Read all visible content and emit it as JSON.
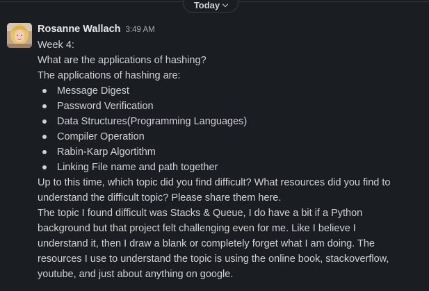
{
  "divider": {
    "label": "Today"
  },
  "message": {
    "author": "Rosanne Wallach",
    "time": "3:49 AM",
    "lines_intro": [
      "Week 4:",
      "What are the applications of hashing?",
      "The applications of hashing are:"
    ],
    "applications": [
      "Message Digest",
      "Password Verification",
      "Data Structures(Programming Languages)",
      "Compiler Operation",
      "Rabin-Karp Algortithm",
      "Linking File name and path together"
    ],
    "lines_question": [
      "Up to this time, which topic did you find difficult? What resources did you find to",
      "understand the difficult topic? Please share them here."
    ],
    "lines_answer": [
      "The topic I found difficult was Stacks & Queue, I do have a bit if a Python",
      "background but that project felt challenging even for me. Like I believe I",
      "understand it, then I draw a blank or completely forget what I am doing. The",
      "resources I use to understand the topic is using the online book,  stackoverflow,",
      "youtube, and just about anything on google."
    ]
  }
}
